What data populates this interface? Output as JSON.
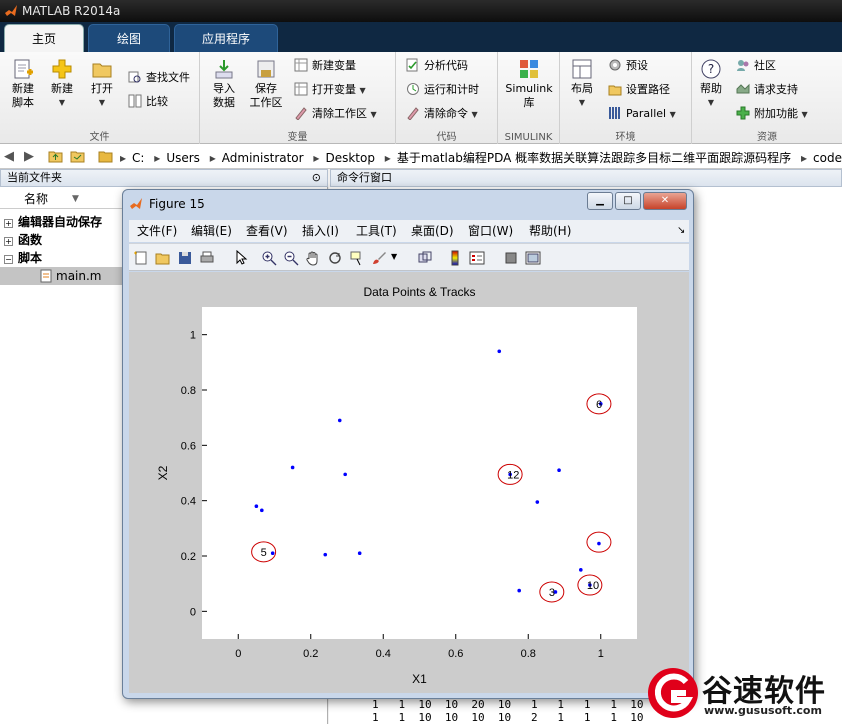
{
  "app": {
    "title": "MATLAB R2014a"
  },
  "tabs": [
    "主页",
    "绘图",
    "应用程序"
  ],
  "ribbon": {
    "file": {
      "new_script": [
        "新建",
        "脚本"
      ],
      "new": "新建",
      "open": "打开",
      "find_files": "查找文件",
      "compare": "比较",
      "group": "文件"
    },
    "variable": {
      "import": [
        "导入",
        "数据"
      ],
      "save_ws": [
        "保存",
        "工作区"
      ],
      "new_var": "新建变量",
      "open_var": "打开变量",
      "clear_ws": "清除工作区",
      "group": "变量"
    },
    "code": {
      "analyze": "分析代码",
      "run_time": "运行和计时",
      "clear_cmd": "清除命令",
      "group": "代码"
    },
    "simulink": {
      "label": [
        "Simulink",
        "库"
      ],
      "group": "SIMULINK"
    },
    "env": {
      "layout": "布局",
      "prefs": "预设",
      "set_path": "设置路径",
      "parallel": "Parallel",
      "group": "环境"
    },
    "res": {
      "help": "帮助",
      "community": "社区",
      "support": "请求支持",
      "addons": "附加功能",
      "group": "资源"
    }
  },
  "address": {
    "crumbs": [
      "C:",
      "Users",
      "Administrator",
      "Desktop",
      "基于matlab编程PDA 概率数据关联算法跟踪多目标二维平面跟踪源码程序",
      "code"
    ]
  },
  "panels": {
    "current_folder": "当前文件夹",
    "command_window": "命令行窗口",
    "name_col": "名称",
    "tree": [
      "编辑器自动保存",
      "函数",
      "脚本"
    ],
    "file": "main.m"
  },
  "cmd_rows": "1   1  10  10  20  10   1   1   1   1  10\n1   1  10  10  10  10   2   1   1   1  10",
  "figure": {
    "title": "Figure 15",
    "menu": [
      "文件(F)",
      "编辑(E)",
      "查看(V)",
      "插入(I)",
      "工具(T)",
      "桌面(D)",
      "窗口(W)",
      "帮助(H)"
    ]
  },
  "chart_data": {
    "type": "scatter",
    "title": "Data Points & Tracks",
    "xlabel": "X1",
    "ylabel": "X2",
    "xlim": [
      -0.1,
      1.1
    ],
    "ylim": [
      -0.1,
      1.1
    ],
    "xticks": [
      0,
      0.2,
      0.4,
      0.6,
      0.8,
      1
    ],
    "yticks": [
      0,
      0.2,
      0.4,
      0.6,
      0.8,
      1
    ],
    "grid": false,
    "marker_color": "#0000ff",
    "ellipse_color": "#cc0000",
    "points": [
      {
        "x": 0.72,
        "y": 0.94
      },
      {
        "x": 0.28,
        "y": 0.69
      },
      {
        "x": 0.15,
        "y": 0.52
      },
      {
        "x": 0.295,
        "y": 0.495
      },
      {
        "x": 0.885,
        "y": 0.51
      },
      {
        "x": 0.05,
        "y": 0.38
      },
      {
        "x": 0.065,
        "y": 0.365
      },
      {
        "x": 0.825,
        "y": 0.395
      },
      {
        "x": 0.24,
        "y": 0.205
      },
      {
        "x": 0.335,
        "y": 0.21
      },
      {
        "x": 0.945,
        "y": 0.15
      },
      {
        "x": 0.775,
        "y": 0.075
      },
      {
        "x": 1.0,
        "y": 0.75
      },
      {
        "x": 0.75,
        "y": 0.495
      },
      {
        "x": 0.995,
        "y": 0.245
      },
      {
        "x": 0.095,
        "y": 0.21
      },
      {
        "x": 0.97,
        "y": 0.095
      },
      {
        "x": 0.875,
        "y": 0.07
      }
    ],
    "tracks": [
      {
        "label": "6",
        "x": 0.995,
        "y": 0.75
      },
      {
        "label": "12",
        "x": 0.75,
        "y": 0.495
      },
      {
        "label": "",
        "x": 0.995,
        "y": 0.25
      },
      {
        "label": "5",
        "x": 0.07,
        "y": 0.215
      },
      {
        "label": "10",
        "x": 0.97,
        "y": 0.095
      },
      {
        "label": "3",
        "x": 0.865,
        "y": 0.07
      }
    ]
  },
  "watermark": {
    "text": "谷速软件",
    "url": "www.gususoft.com"
  }
}
